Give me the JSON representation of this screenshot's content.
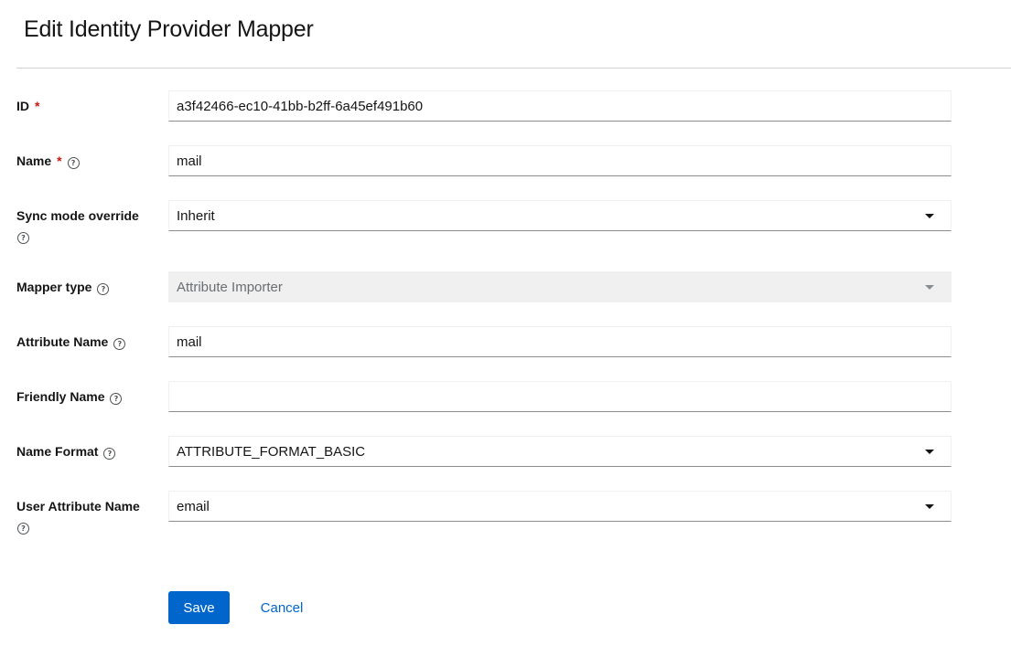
{
  "page": {
    "title": "Edit Identity Provider Mapper"
  },
  "form": {
    "id": {
      "label": "ID",
      "required_mark": "*",
      "value": "a3f42466-ec10-41bb-b2ff-6a45ef491b60"
    },
    "name": {
      "label": "Name",
      "required_mark": "*",
      "help_icon": "?",
      "value": "mail"
    },
    "sync_mode_override": {
      "label": "Sync mode override",
      "help_icon": "?",
      "value": "Inherit"
    },
    "mapper_type": {
      "label": "Mapper type",
      "help_icon": "?",
      "value": "Attribute Importer",
      "disabled": true
    },
    "attribute_name": {
      "label": "Attribute Name",
      "help_icon": "?",
      "value": "mail"
    },
    "friendly_name": {
      "label": "Friendly Name",
      "help_icon": "?",
      "value": ""
    },
    "name_format": {
      "label": "Name Format",
      "help_icon": "?",
      "value": "ATTRIBUTE_FORMAT_BASIC"
    },
    "user_attribute_name": {
      "label": "User Attribute Name",
      "help_icon": "?",
      "value": "email"
    }
  },
  "actions": {
    "save_label": "Save",
    "cancel_label": "Cancel"
  },
  "colors": {
    "primary": "#0066cc",
    "required": "#c9190b",
    "disabled_bg": "#f0f0f0",
    "border_bottom": "#8a8d90"
  }
}
